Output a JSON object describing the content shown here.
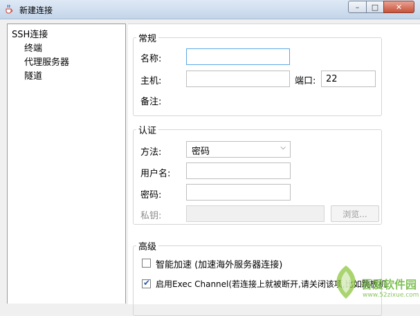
{
  "window": {
    "title": "新建连接",
    "minimize_glyph": "–",
    "maximize_glyph": "□",
    "close_glyph": "✕"
  },
  "sidebar": {
    "items": [
      {
        "label": "SSH连接"
      },
      {
        "label": "终端"
      },
      {
        "label": "代理服务器"
      },
      {
        "label": "隧道"
      }
    ]
  },
  "general": {
    "title": "常规",
    "name_label": "名称:",
    "name_value": "",
    "host_label": "主机:",
    "host_value": "",
    "port_label": "端口:",
    "port_value": "22",
    "note_label": "备注:",
    "note_value": ""
  },
  "auth": {
    "title": "认证",
    "method_label": "方法:",
    "method_value": "密码",
    "username_label": "用户名:",
    "username_value": "",
    "password_label": "密码:",
    "password_value": "",
    "key_label": "私钥:",
    "key_value": "",
    "browse_label": "浏览..."
  },
  "advanced": {
    "title": "高级",
    "smart_accel_label": "智能加速 (加速海外服务器连接)",
    "smart_accel_checked": false,
    "exec_channel_label": "启用Exec Channel(若连接上就被断开,请关闭该项,比如跳板机",
    "exec_channel_checked": true
  },
  "watermark": {
    "brand": "吾爱软件园",
    "url": "www.52zixue.com"
  },
  "colors": {
    "titlebar_top": "#dfe9f5",
    "titlebar_bottom": "#c4d5ea",
    "close_button": "#c8513a",
    "focus_border": "#5aa7e6",
    "checkbox_tick": "#2b5fa8",
    "watermark_green": "#6bb53a"
  },
  "icons": {
    "app": "java-cup-icon",
    "dropdown": "chevron-down-icon",
    "checkbox_tick": "checkmark-icon"
  }
}
